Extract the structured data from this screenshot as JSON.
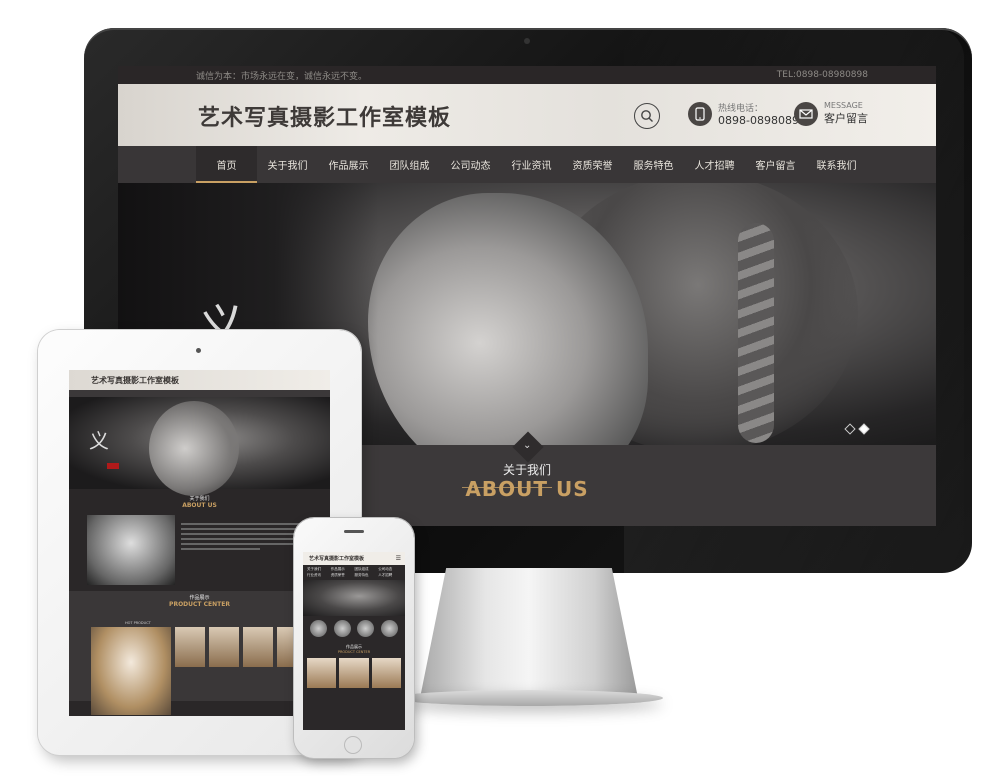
{
  "desktop": {
    "topbar": {
      "slogan": "诚信为本：市场永远在变，诚信永远不变。",
      "tel": "TEL:0898-08980898"
    },
    "header": {
      "site_title": "艺术写真摄影工作室模板",
      "hotline_label": "热线电话：",
      "hotline_number": "0898-08980898",
      "message_label": "MESSAGE",
      "message_text": "客户留言"
    },
    "nav": [
      "首页",
      "关于我们",
      "作品展示",
      "团队组成",
      "公司动态",
      "行业资讯",
      "资质荣誉",
      "服务特色",
      "人才招聘",
      "客户留言",
      "联系我们"
    ],
    "about": {
      "title_cn": "关于我们",
      "title_en": "ABOUT US"
    }
  },
  "tablet": {
    "site_title": "艺术写真摄影工作室模板",
    "about_cn": "关于我们",
    "about_en": "ABOUT US",
    "product_cn": "作品展示",
    "product_en": "PRODUCT CENTER",
    "hot_product": "HOT PRODUCT"
  },
  "phone": {
    "site_title": "艺术写真摄影工作室模板",
    "menu_icon": "☰",
    "nav": [
      "关于我们",
      "作品展示",
      "团队组成",
      "公司动态",
      "行业资讯",
      "资质荣誉",
      "服务特色",
      "人才招聘"
    ],
    "product_cn": "作品展示",
    "product_en": "PRODUCT CENTER"
  },
  "colors": {
    "accent_gold": "#c9a063",
    "nav_bg": "#393637"
  }
}
